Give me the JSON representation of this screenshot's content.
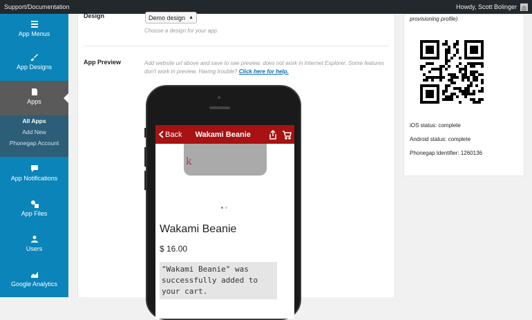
{
  "admin_bar": {
    "left_link": "Support/Documentation",
    "howdy": "Howdy, Scott Bolinger"
  },
  "sidebar": {
    "items": [
      {
        "label": "App Menus",
        "icon": "list-icon"
      },
      {
        "label": "App Designs",
        "icon": "brush-icon"
      },
      {
        "label": "Apps",
        "icon": "document-icon"
      },
      {
        "label": "App Notifications",
        "icon": "chat-icon"
      },
      {
        "label": "App Files",
        "icon": "media-icon"
      },
      {
        "label": "Users",
        "icon": "user-icon"
      },
      {
        "label": "Google Analytics",
        "icon": "chart-icon"
      }
    ],
    "submenu": [
      "All Apps",
      "Add New",
      "Phonegap Account"
    ]
  },
  "design": {
    "label": "Design",
    "select_value": "Demo design",
    "hint": "Choose a design for your app."
  },
  "preview": {
    "label": "App Preview",
    "hint_part1": "Add website url above and save to see preview, does not work in Internet Explorer.",
    "hint_part2": "Some features don't work in preview. Having trouble?",
    "help_link": "Click here for help."
  },
  "app_screen": {
    "back_label": "Back",
    "title": "Wakami Beanie",
    "product_name": "Wakami Beanie",
    "price": "$ 16.00",
    "notice": "\"Wakami Beanie\" was successfully added to your cart.",
    "beanie_letter": "k"
  },
  "right_panel": {
    "top_text": "provisioning profile)",
    "ios_status": "iOS status: complete",
    "android_status": "Android status: complete",
    "phonegap_id": "Phonegap Identifier: 1260136"
  },
  "colors": {
    "sidebar": "#0a84b9",
    "admin_bar": "#23282d",
    "app_bar": "#a81212",
    "link": "#0a6fb3"
  }
}
